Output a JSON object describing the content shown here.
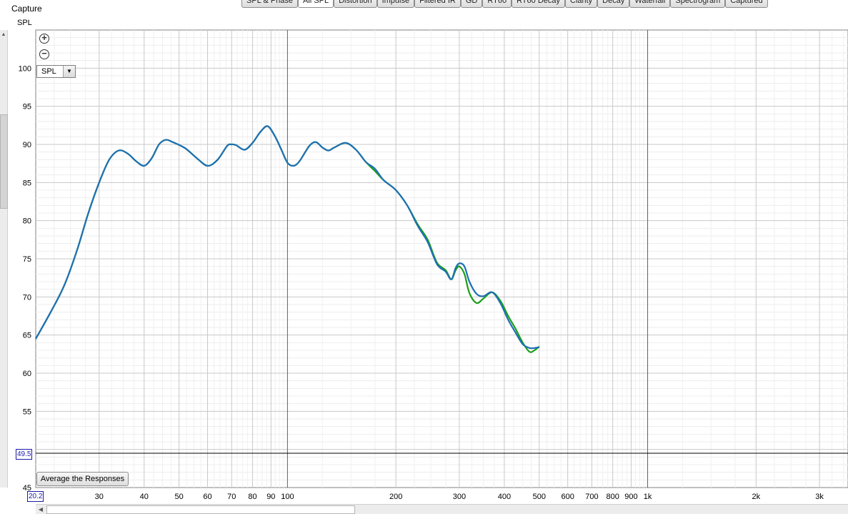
{
  "panel": {
    "title": "Capture",
    "y_axis_title": "SPL"
  },
  "tabs": [
    {
      "label": "SPL & Phase",
      "active": false
    },
    {
      "label": "All SPL",
      "active": true
    },
    {
      "label": "Distortion",
      "active": false
    },
    {
      "label": "Impulse",
      "active": false
    },
    {
      "label": "Filtered IR",
      "active": false
    },
    {
      "label": "GD",
      "active": false
    },
    {
      "label": "RT60",
      "active": false
    },
    {
      "label": "RT60 Decay",
      "active": false
    },
    {
      "label": "Clarity",
      "active": false
    },
    {
      "label": "Decay",
      "active": false
    },
    {
      "label": "Waterfall",
      "active": false
    },
    {
      "label": "Spectrogram",
      "active": false
    },
    {
      "label": "Captured",
      "active": false
    }
  ],
  "controls": {
    "zoom_in_icon": "plus-circle-icon",
    "zoom_out_icon": "minus-circle-icon",
    "zoom_in_glyph": "+",
    "zoom_out_glyph": "−",
    "spl_select_value": "SPL",
    "average_button_label": "Average the Responses",
    "cursor_y_value": "49.5",
    "cursor_x_value": "20.2"
  },
  "chart_data": {
    "type": "line",
    "x_scale": "log",
    "xlim": [
      20,
      3600
    ],
    "ylim": [
      45,
      105
    ],
    "grid": true,
    "y_ticks": [
      45,
      50,
      55,
      60,
      65,
      70,
      75,
      80,
      85,
      90,
      95,
      100
    ],
    "y_tick_labels": [
      "45",
      "",
      "55",
      "60",
      "65",
      "70",
      "75",
      "80",
      "85",
      "90",
      "95",
      "100"
    ],
    "x_ticks": [
      30,
      40,
      50,
      60,
      70,
      80,
      90,
      100,
      200,
      300,
      400,
      500,
      600,
      700,
      800,
      900,
      1000,
      2000,
      3000
    ],
    "x_tick_labels": [
      "30",
      "40",
      "50",
      "60",
      "70",
      "80",
      "90",
      "100",
      "200",
      "300",
      "400",
      "500",
      "600",
      "700",
      "800",
      "900",
      "1k",
      "2k",
      "3k"
    ],
    "cursor_y": 49.5,
    "series": [
      {
        "color": "#1a9e1a",
        "points": [
          [
            20,
            64.5
          ],
          [
            22,
            68
          ],
          [
            24,
            71.5
          ],
          [
            26,
            76
          ],
          [
            28,
            81
          ],
          [
            30,
            85
          ],
          [
            32,
            88
          ],
          [
            34,
            89.2
          ],
          [
            36,
            88.8
          ],
          [
            38,
            87.8
          ],
          [
            40,
            87.2
          ],
          [
            42,
            88.2
          ],
          [
            44,
            90
          ],
          [
            46,
            90.6
          ],
          [
            48,
            90.3
          ],
          [
            52,
            89.5
          ],
          [
            56,
            88.2
          ],
          [
            60,
            87.2
          ],
          [
            64,
            88
          ],
          [
            68,
            89.8
          ],
          [
            70,
            90
          ],
          [
            72,
            89.9
          ],
          [
            76,
            89.3
          ],
          [
            80,
            90.2
          ],
          [
            84,
            91.6
          ],
          [
            88,
            92.4
          ],
          [
            92,
            91.2
          ],
          [
            96,
            89.4
          ],
          [
            100,
            87.6
          ],
          [
            104,
            87.2
          ],
          [
            108,
            87.8
          ],
          [
            115,
            89.8
          ],
          [
            120,
            90.3
          ],
          [
            125,
            89.6
          ],
          [
            130,
            89.2
          ],
          [
            135,
            89.6
          ],
          [
            145,
            90.2
          ],
          [
            155,
            89.3
          ],
          [
            165,
            87.7
          ],
          [
            175,
            86.5
          ],
          [
            185,
            85.3
          ],
          [
            200,
            84
          ],
          [
            215,
            82
          ],
          [
            230,
            79.5
          ],
          [
            245,
            77.5
          ],
          [
            260,
            74.5
          ],
          [
            275,
            73.5
          ],
          [
            285,
            72.3
          ],
          [
            293,
            73.5
          ],
          [
            300,
            74
          ],
          [
            310,
            73
          ],
          [
            320,
            70.5
          ],
          [
            335,
            69.2
          ],
          [
            350,
            69.8
          ],
          [
            370,
            70.6
          ],
          [
            390,
            69.5
          ],
          [
            410,
            67.5
          ],
          [
            430,
            65.8
          ],
          [
            450,
            64
          ],
          [
            470,
            62.8
          ],
          [
            485,
            63
          ],
          [
            500,
            63.5
          ]
        ]
      },
      {
        "color": "#1f6fb5",
        "points": [
          [
            20,
            64.5
          ],
          [
            22,
            68
          ],
          [
            24,
            71.5
          ],
          [
            26,
            76
          ],
          [
            28,
            81
          ],
          [
            30,
            85
          ],
          [
            32,
            88
          ],
          [
            34,
            89.2
          ],
          [
            36,
            88.8
          ],
          [
            38,
            87.8
          ],
          [
            40,
            87.2
          ],
          [
            42,
            88.2
          ],
          [
            44,
            90
          ],
          [
            46,
            90.6
          ],
          [
            48,
            90.3
          ],
          [
            52,
            89.5
          ],
          [
            56,
            88.2
          ],
          [
            60,
            87.2
          ],
          [
            64,
            88
          ],
          [
            68,
            89.8
          ],
          [
            70,
            90
          ],
          [
            72,
            89.9
          ],
          [
            76,
            89.3
          ],
          [
            80,
            90.2
          ],
          [
            84,
            91.6
          ],
          [
            88,
            92.4
          ],
          [
            92,
            91.2
          ],
          [
            96,
            89.4
          ],
          [
            100,
            87.6
          ],
          [
            104,
            87.2
          ],
          [
            108,
            87.8
          ],
          [
            115,
            89.8
          ],
          [
            120,
            90.3
          ],
          [
            125,
            89.6
          ],
          [
            130,
            89.2
          ],
          [
            135,
            89.6
          ],
          [
            145,
            90.2
          ],
          [
            155,
            89.3
          ],
          [
            165,
            87.7
          ],
          [
            175,
            86.8
          ],
          [
            185,
            85.3
          ],
          [
            200,
            84
          ],
          [
            215,
            82
          ],
          [
            230,
            79.3
          ],
          [
            245,
            77.2
          ],
          [
            260,
            74.3
          ],
          [
            275,
            73.3
          ],
          [
            285,
            72.3
          ],
          [
            293,
            73.8
          ],
          [
            300,
            74.4
          ],
          [
            310,
            74
          ],
          [
            320,
            72
          ],
          [
            335,
            70.4
          ],
          [
            350,
            70.1
          ],
          [
            370,
            70.6
          ],
          [
            390,
            69.2
          ],
          [
            410,
            67
          ],
          [
            430,
            65.3
          ],
          [
            450,
            63.8
          ],
          [
            470,
            63.3
          ],
          [
            485,
            63.3
          ],
          [
            500,
            63.4
          ]
        ]
      }
    ]
  }
}
